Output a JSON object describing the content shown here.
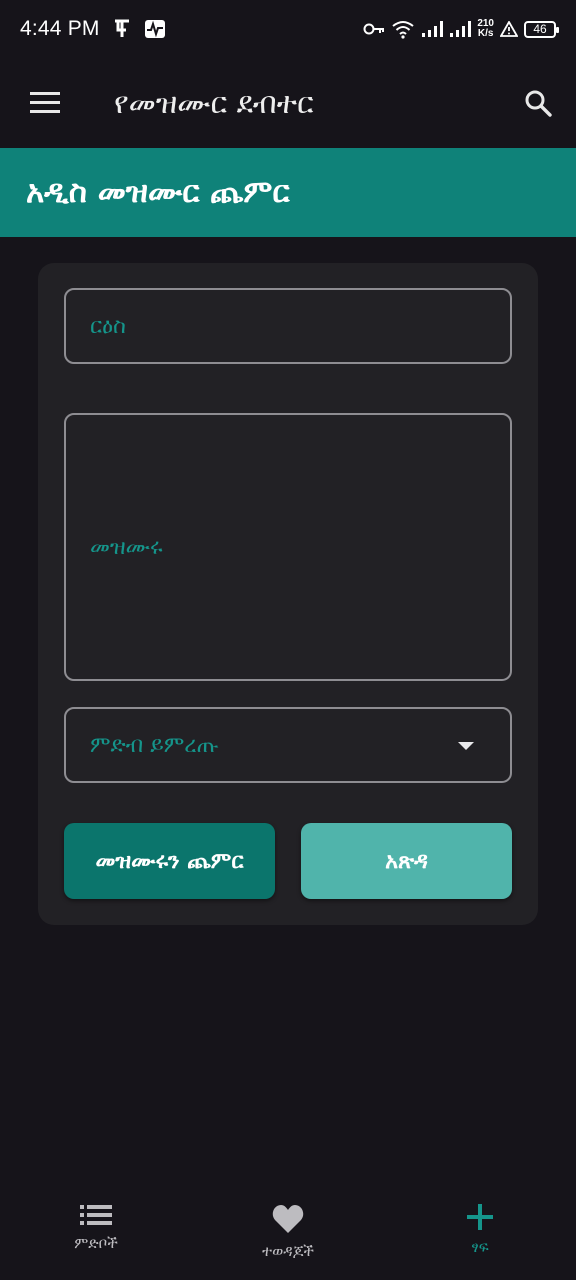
{
  "status_bar": {
    "time": "4:44 PM",
    "net_speed_value": "210",
    "net_speed_unit": "K/s",
    "battery": "46"
  },
  "app_bar": {
    "title": "የመዝሙር ደብተር",
    "menu_icon": "hamburger-menu-icon",
    "search_icon": "search-icon"
  },
  "banner": {
    "title": "አዲስ መዝሙር ጨምር"
  },
  "form": {
    "title_placeholder": "ርዕስ",
    "body_placeholder": "መዝሙሩ",
    "category_placeholder": "ምድብ ይምረጡ",
    "add_button": "መዝሙሩን ጨምር",
    "clear_button": "አጽዳ"
  },
  "bottom_nav": {
    "items": [
      {
        "label": "ምድቦች",
        "icon": "list-icon",
        "active": false
      },
      {
        "label": "ተወዳጆች",
        "icon": "heart-icon",
        "active": false
      },
      {
        "label": "ፃፍ",
        "icon": "plus-icon",
        "active": true
      }
    ]
  },
  "colors": {
    "background": "#16141a",
    "accent": "#0f8279",
    "accent_light": "#50b4ab",
    "card": "#222125",
    "placeholder": "#15958b"
  }
}
